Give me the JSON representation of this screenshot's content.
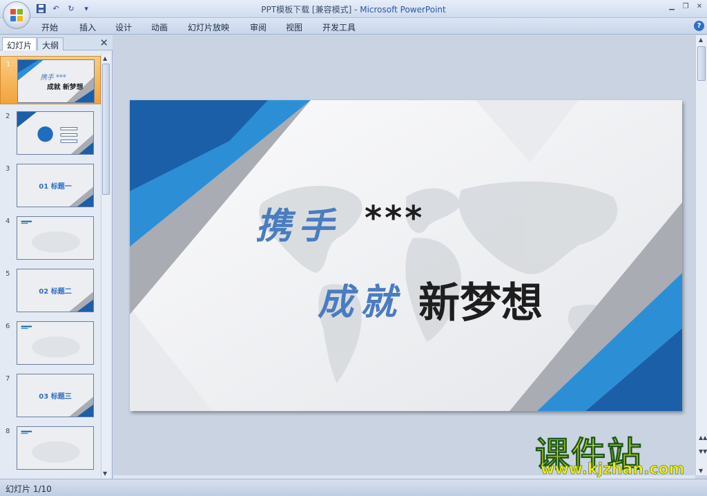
{
  "window": {
    "title": "PPT模板下载 [兼容模式]",
    "separator": " - ",
    "app_name": "Microsoft PowerPoint",
    "icons": [
      "office-button",
      "save-icon",
      "undo-icon",
      "redo-icon",
      "customize-icon",
      "minimize-icon",
      "restore-icon",
      "close-icon",
      "help-icon"
    ]
  },
  "ribbon": {
    "tabs": [
      "开始",
      "插入",
      "设计",
      "动画",
      "幻灯片放映",
      "审阅",
      "视图",
      "开发工具"
    ],
    "help_label": "?"
  },
  "pane": {
    "tabs": [
      "幻灯片",
      "大纲"
    ],
    "close_label": "✕"
  },
  "thumbnails": [
    {
      "num": "1",
      "title": "",
      "kind": "cover"
    },
    {
      "num": "2",
      "title": "",
      "kind": "toc"
    },
    {
      "num": "3",
      "title": "01 标题一",
      "kind": "section"
    },
    {
      "num": "4",
      "title": "",
      "kind": "content"
    },
    {
      "num": "5",
      "title": "02 标题二",
      "kind": "section"
    },
    {
      "num": "6",
      "title": "",
      "kind": "content"
    },
    {
      "num": "7",
      "title": "03 标题三",
      "kind": "section"
    },
    {
      "num": "8",
      "title": "",
      "kind": "content"
    }
  ],
  "slide": {
    "line1_calli": "携手",
    "line1_bold": "***",
    "line2_calli": "成就",
    "line2_bold": "新梦想"
  },
  "status": {
    "text": "幻灯片 1/10"
  },
  "watermark": {
    "cn": "课件站",
    "url": "www.kjzhan.com"
  },
  "colors": {
    "accent_blue": "#1b5fa8",
    "light_blue": "#2c8fd6",
    "gray": "#a9acb2",
    "selected_thumb": "#f3a23c"
  }
}
